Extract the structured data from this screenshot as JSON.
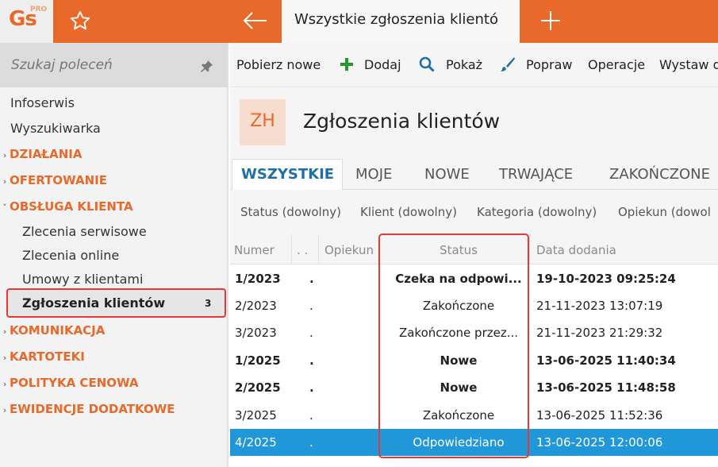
{
  "topbar": {
    "logo": "Gs",
    "logo_suffix": "PRO",
    "active_tab": "Wszystkie zgłoszenia klientó",
    "icons": [
      "star-icon",
      "back-arrow-icon",
      "plus-icon"
    ]
  },
  "sidebar": {
    "search_placeholder": "Szukaj poleceń",
    "items": [
      {
        "label": "Infoserwis"
      },
      {
        "label": "Wyszukiwarka"
      }
    ],
    "sections": [
      {
        "label": "DZIAŁANIA",
        "expanded": false
      },
      {
        "label": "OFERTOWANIE",
        "expanded": false
      },
      {
        "label": "OBSŁUGA KLIENTA",
        "expanded": true
      },
      {
        "label": "KOMUNIKACJA",
        "expanded": false
      },
      {
        "label": "KARTOTEKI",
        "expanded": false
      },
      {
        "label": "POLITYKA CENOWA",
        "expanded": false
      },
      {
        "label": "EWIDENCJE DODATKOWE",
        "expanded": false
      }
    ],
    "subitems": [
      {
        "label": "Zlecenia serwisowe"
      },
      {
        "label": "Zlecenia online"
      },
      {
        "label": "Umowy z klientami"
      },
      {
        "label": "Zgłoszenia klientów",
        "badge": "3"
      }
    ]
  },
  "toolbar": {
    "fetch_new": "Pobierz nowe",
    "add": "Dodaj",
    "show": "Pokaż",
    "edit": "Popraw",
    "operations": "Operacje",
    "issue": "Wystaw d"
  },
  "header": {
    "code": "ZH",
    "title": "Zgłoszenia klientów"
  },
  "tabs": [
    "WSZYSTKIE",
    "MOJE",
    "NOWE",
    "TRWAJĄCE",
    "ZAKOŃCZONE"
  ],
  "filters": [
    "Status (dowolny)",
    "Klient (dowolny)",
    "Kategoria (dowolny)",
    "Opiekun (dowol"
  ],
  "grid": {
    "columns": [
      "Numer",
      ". .",
      "Opiekun",
      "Status",
      "Data dodania"
    ],
    "rows": [
      {
        "numer": "1/2023",
        "dot": ".",
        "opiekun": "",
        "status": "Czeka na odpowi...",
        "data": "19-10-2023 09:25:24",
        "bold": true
      },
      {
        "numer": "2/2023",
        "dot": ".",
        "opiekun": "",
        "status": "Zakończone",
        "data": "21-11-2023 13:07:19",
        "bold": false
      },
      {
        "numer": "3/2023",
        "dot": ".",
        "opiekun": "",
        "status": "Zakończone przez...",
        "data": "21-11-2023 21:29:32",
        "bold": false
      },
      {
        "numer": "1/2025",
        "dot": ".",
        "opiekun": "",
        "status": "Nowe",
        "data": "13-06-2025 11:40:34",
        "bold": true
      },
      {
        "numer": "2/2025",
        "dot": ".",
        "opiekun": "",
        "status": "Nowe",
        "data": "13-06-2025 11:48:58",
        "bold": true
      },
      {
        "numer": "3/2025",
        "dot": ".",
        "opiekun": "",
        "status": "Zakończone",
        "data": "13-06-2025 11:52:36",
        "bold": false
      },
      {
        "numer": "4/2025",
        "dot": ".",
        "opiekun": "",
        "status": "Odpowiedziano",
        "data": "13-06-2025 12:00:06",
        "bold": false,
        "selected": true
      }
    ]
  },
  "colors": {
    "brand": "#e8692a",
    "selection": "#1f97d9",
    "highlight_outline": "#e53935",
    "tab_active": "#1e6fa8"
  }
}
